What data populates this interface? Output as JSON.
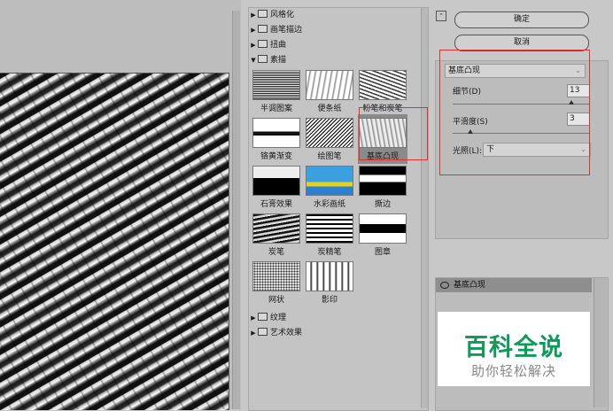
{
  "gallery": {
    "categories": {
      "artistic": "风格化",
      "brush": "画笔描边",
      "distort": "扭曲",
      "sketch": "素描",
      "texture": "纹理",
      "effects": "艺术效果"
    },
    "thumbs": [
      {
        "label": "半调图案",
        "icon": "halftone-thumb"
      },
      {
        "label": "便条纸",
        "icon": "note-paper-thumb"
      },
      {
        "label": "粉笔和炭笔",
        "icon": "chalk-charcoal-thumb"
      },
      {
        "label": "铬黄渐变",
        "icon": "chrome-thumb"
      },
      {
        "label": "绘图笔",
        "icon": "graphic-pen-thumb"
      },
      {
        "label": "基底凸现",
        "icon": "bas-relief-thumb"
      },
      {
        "label": "石膏效果",
        "icon": "plaster-thumb"
      },
      {
        "label": "水彩画纸",
        "icon": "water-paper-thumb"
      },
      {
        "label": "撕边",
        "icon": "torn-edges-thumb"
      },
      {
        "label": "炭笔",
        "icon": "charcoal-thumb"
      },
      {
        "label": "炭精笔",
        "icon": "conte-crayon-thumb"
      },
      {
        "label": "图章",
        "icon": "stamp-thumb"
      },
      {
        "label": "网状",
        "icon": "reticulation-thumb"
      },
      {
        "label": "影印",
        "icon": "photocopy-thumb"
      }
    ],
    "selected_index": 5
  },
  "buttons": {
    "ok": "确定",
    "cancel": "取消"
  },
  "settings": {
    "filter": "基底凸现",
    "detail_label": "细节(D)",
    "detail_value": "13",
    "detail_fraction": 0.87,
    "smooth_label": "平滑度(S)",
    "smooth_value": "3",
    "smooth_fraction": 0.13,
    "light_label": "光照(L):",
    "light_value": "下"
  },
  "layers": {
    "item": "基底凸现"
  },
  "watermark": {
    "main": "百科全说",
    "sub": "助你轻松解决"
  },
  "colors": {
    "highlight": "#e03030",
    "watermark": "#0e9a58"
  }
}
